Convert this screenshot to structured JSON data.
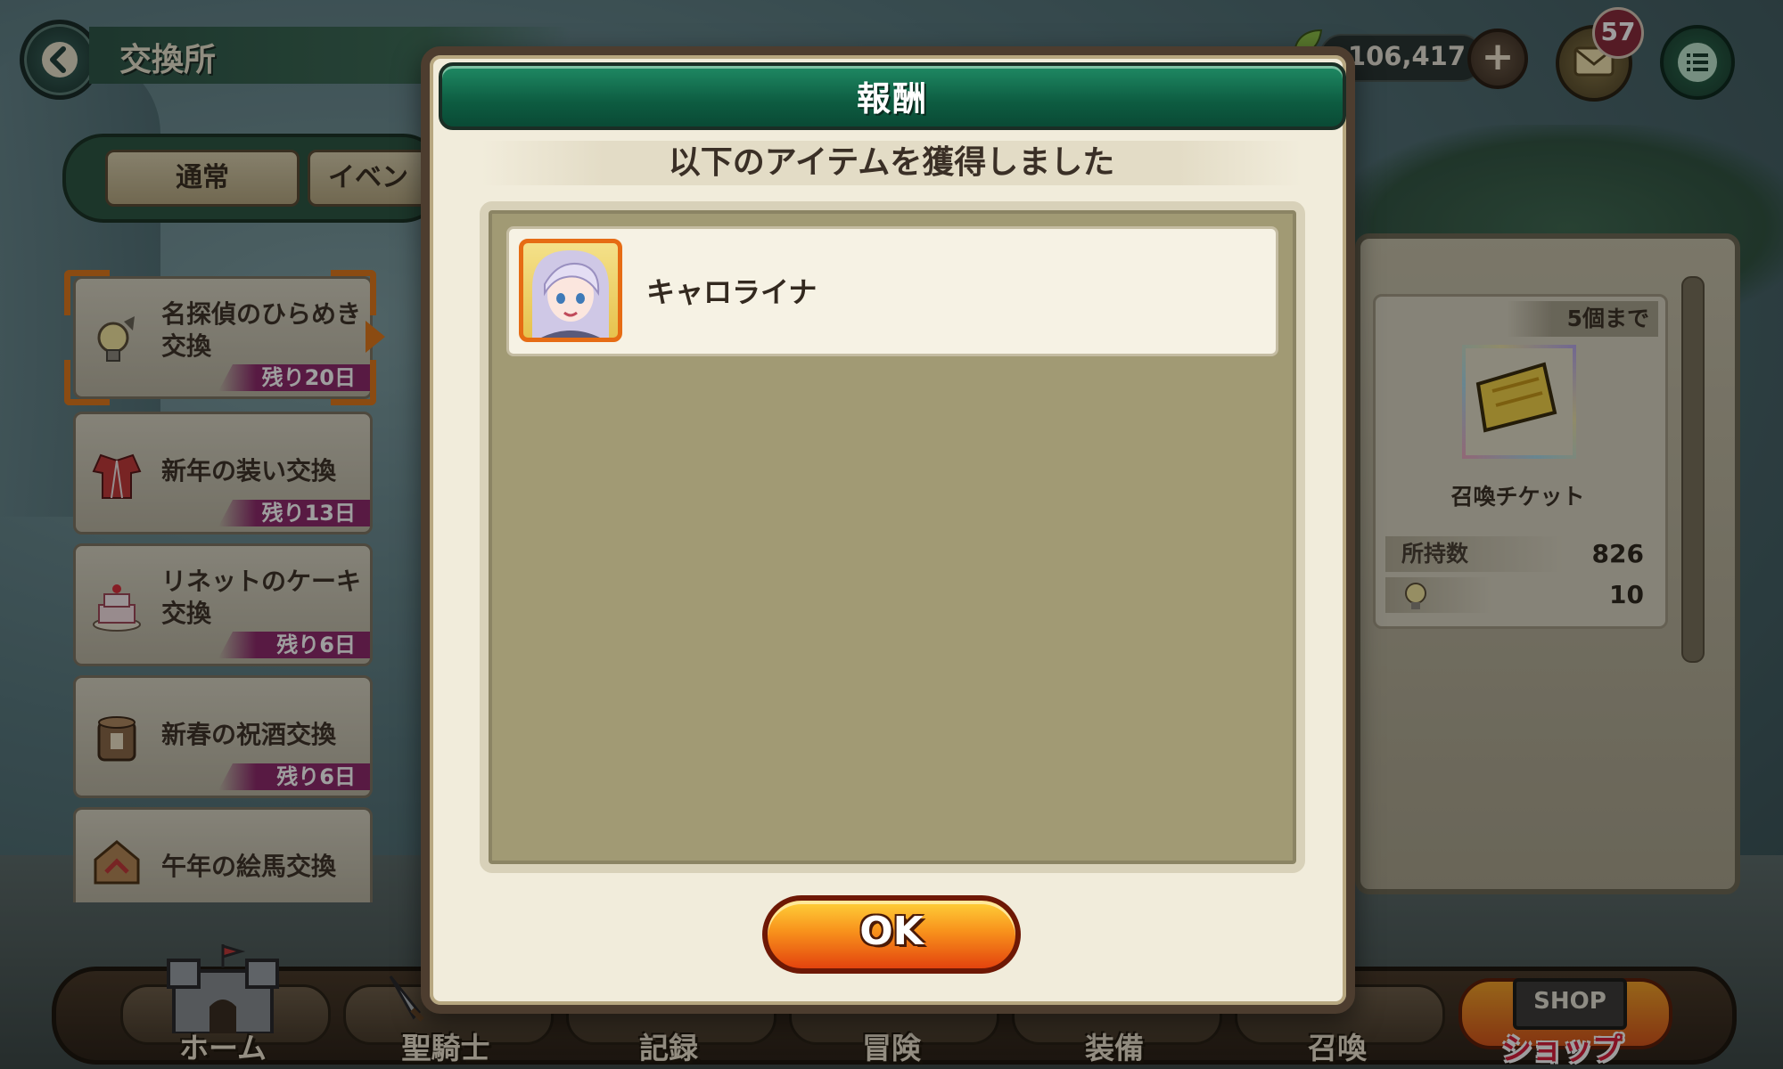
{
  "header": {
    "title": "交換所",
    "currency_amount": "106,417",
    "mail_badge_count": "57"
  },
  "tabs": [
    {
      "label": "通常"
    },
    {
      "label": "イベン"
    }
  ],
  "exchange_list": [
    {
      "name": "名探偵のひらめき交換",
      "remaining": "残り20日",
      "icon": "lightbulb-icon",
      "selected": true
    },
    {
      "name": "新年の装い交換",
      "remaining": "残り13日",
      "icon": "kimono-icon",
      "selected": false
    },
    {
      "name": "リネットのケーキ交換",
      "remaining": "残り6日",
      "icon": "cake-icon",
      "selected": false
    },
    {
      "name": "新春の祝酒交換",
      "remaining": "残り6日",
      "icon": "sake-barrel-icon",
      "selected": false
    },
    {
      "name": "午年の絵馬交換",
      "remaining": "",
      "icon": "ema-icon",
      "selected": false
    }
  ],
  "detail": {
    "limit": "5個まで",
    "item_name": "召喚チケット",
    "owned_label": "所持数",
    "owned_value": "826",
    "cost_value": "10"
  },
  "bottom_nav": [
    {
      "label": "ホーム",
      "icon": "castle-icon"
    },
    {
      "label": "聖騎士",
      "icon": "sword-icon"
    },
    {
      "label": "記録",
      "icon": "book-icon"
    },
    {
      "label": "冒険",
      "icon": "map-icon"
    },
    {
      "label": "装備",
      "icon": "armor-icon"
    },
    {
      "label": "召喚",
      "icon": "summon-icon"
    },
    {
      "label": "ショップ",
      "icon": "shop-sign-icon",
      "sign": "SHOP"
    }
  ],
  "dialog": {
    "title": "報酬",
    "message": "以下のアイテムを獲得しました",
    "rewards": [
      {
        "name": "キャロライナ",
        "icon": "character-portrait-icon"
      }
    ],
    "ok_label": "OK"
  },
  "colors": {
    "dialog_header": "#0d5c41",
    "ok_button": "#f8921c",
    "remaining_tag": "#8e2a6c",
    "selection_bracket": "#e07a1e"
  }
}
